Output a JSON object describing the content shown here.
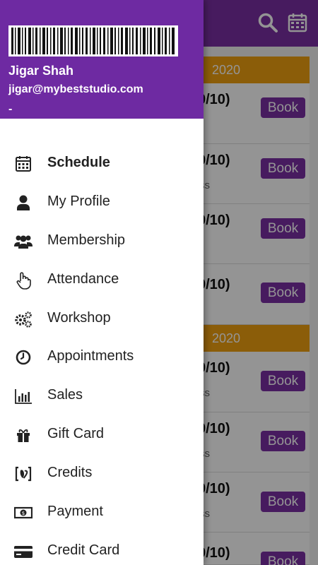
{
  "app_bar": {
    "search_icon": "search-icon",
    "calendar_icon": "calendar-icon"
  },
  "date_bands": [
    {
      "text": "2020"
    },
    {
      "text": "2020"
    }
  ],
  "cards": [
    {
      "title": "0/10)",
      "sub": "",
      "button": "Book"
    },
    {
      "title": "0/10)",
      "sub": "ss",
      "button": "Book"
    },
    {
      "title": "0/10)",
      "sub": "",
      "button": "Book"
    },
    {
      "title": "0/10)",
      "sub": "",
      "button": "Book"
    },
    {
      "title": "0/10)",
      "sub": "ss",
      "button": "Book"
    },
    {
      "title": "0/10)",
      "sub": "ss",
      "button": "Book"
    },
    {
      "title": "0/10)",
      "sub": "ss",
      "button": "Book"
    },
    {
      "title": "0/10)",
      "sub": "",
      "button": "Book"
    }
  ],
  "drawer": {
    "user": {
      "name": "Jigar Shah",
      "email": "jigar@mybeststudio.com",
      "extra": "-"
    },
    "menu": [
      {
        "label": "Schedule",
        "icon": "calendar-icon",
        "active": true
      },
      {
        "label": "My Profile",
        "icon": "user-icon"
      },
      {
        "label": "Membership",
        "icon": "users-icon"
      },
      {
        "label": "Attendance",
        "icon": "hand-pointer-icon"
      },
      {
        "label": "Workshop",
        "icon": "gears-icon"
      },
      {
        "label": "Appointments",
        "icon": "clock-icon"
      },
      {
        "label": "Sales",
        "icon": "bar-chart-icon"
      },
      {
        "label": "Gift Card",
        "icon": "gift-icon"
      },
      {
        "label": "Credits",
        "icon": "credits-icon"
      },
      {
        "label": "Payment",
        "icon": "money-icon"
      },
      {
        "label": "Credit Card",
        "icon": "credit-card-icon"
      }
    ]
  },
  "colors": {
    "primary": "#7b2fa4",
    "accent": "#f0a010",
    "header": "#6e2aa2"
  }
}
